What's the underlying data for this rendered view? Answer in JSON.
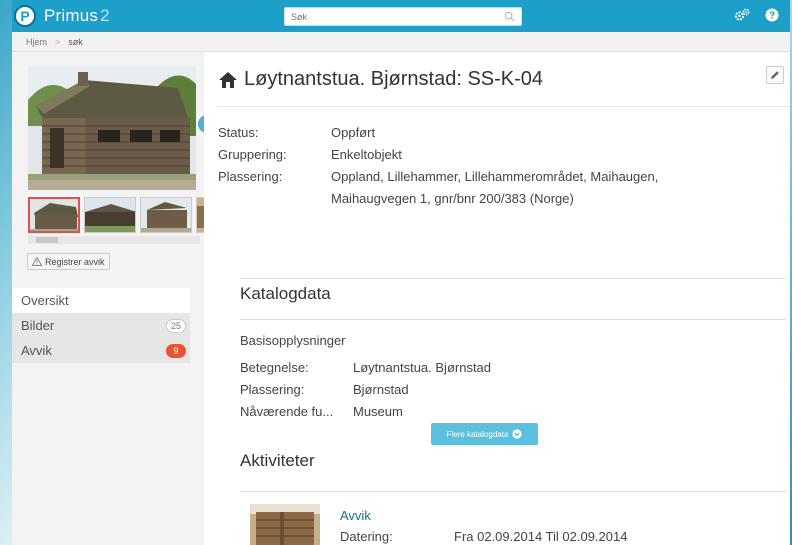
{
  "app": {
    "name": "Primus",
    "version": "2"
  },
  "search": {
    "placeholder": "Søk"
  },
  "breadcrumb": {
    "home": "Hjem",
    "sep": ">",
    "current": "søk"
  },
  "left": {
    "register_label": "Registrer avvik",
    "nav": [
      {
        "label": "Oversikt"
      },
      {
        "label": "Bilder",
        "count": "25"
      },
      {
        "label": "Avvik",
        "count": "9"
      }
    ]
  },
  "main": {
    "title": "Løytnantstua. Bjørnstad: SS-K-04",
    "facts": [
      {
        "label": "Status:",
        "value": "Oppført"
      },
      {
        "label": "Gruppering:",
        "value": "Enkeltobjekt"
      },
      {
        "label": "Plassering:",
        "value": "Oppland, Lillehammer, Lillehammerområdet, Maihaugen, Maihaugvegen 1, gnr/bnr 200/383 (Norge)"
      }
    ],
    "katalog": {
      "heading": "Katalogdata",
      "subheading": "Basisopplysninger",
      "rows": [
        {
          "label": "Betegnelse:",
          "value": "Løytnantstua. Bjørnstad"
        },
        {
          "label": "Plassering:",
          "value": "Bjørnstad"
        },
        {
          "label": "Nåværende fu...",
          "value": "Museum"
        }
      ],
      "more_label": "Flere katalogdata"
    },
    "aktiviteter": {
      "heading": "Aktiviteter",
      "item_title": "Avvik",
      "date_label": "Datering:",
      "date_value": "Fra 02.09.2014 Til 02.09.2014"
    }
  },
  "colors": {
    "topbar": "#1c9fc9",
    "accent": "#5bc0de",
    "badge_red": "#e8542f",
    "link": "#1a6f96"
  }
}
